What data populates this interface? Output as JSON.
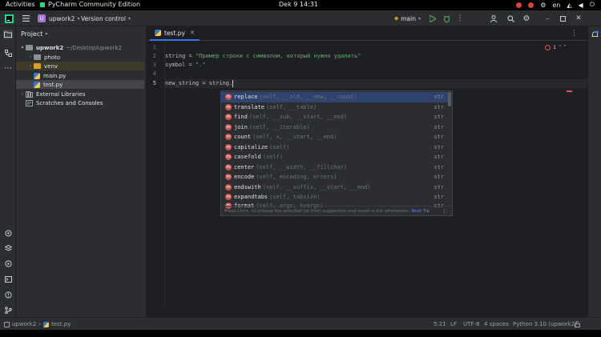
{
  "system_bar": {
    "activities": "Activities",
    "app_name": "PyCharm Community Edition",
    "clock": "Dek 9  14:31",
    "language": "en"
  },
  "toolbar": {
    "project_badge": "U",
    "project_name": "upwork2",
    "vcs": "Version control",
    "run_config": "main"
  },
  "project_panel": {
    "title": "Project",
    "tree": [
      {
        "label": "upwork2",
        "path": "~/Desktop/upwork2",
        "kind": "root"
      },
      {
        "label": "photo",
        "kind": "folder"
      },
      {
        "label": "venv",
        "kind": "folder-excluded"
      },
      {
        "label": "main.py",
        "kind": "py"
      },
      {
        "label": "test.py",
        "kind": "py",
        "selected": true
      },
      {
        "label": "External Libraries",
        "kind": "lib"
      },
      {
        "label": "Scratches and Consoles",
        "kind": "scratch"
      }
    ]
  },
  "editor": {
    "tab_label": "test.py",
    "inspection_count": "1",
    "line_numbers": [
      "1",
      "2",
      "3",
      "4",
      "5"
    ],
    "line2_var": "string = ",
    "line2_str": "\"Пример строки с символом, который нужно удалить\"",
    "line3_var": "symbol = ",
    "line3_str": "\".\"",
    "line5": "new_string = string."
  },
  "completion": {
    "items": [
      {
        "name": "replace",
        "sig": "(self, __old, __new, __count)",
        "type": "str"
      },
      {
        "name": "translate",
        "sig": "(self, __table)",
        "type": "str"
      },
      {
        "name": "find",
        "sig": "(self, __sub, __start, __end)",
        "type": "str"
      },
      {
        "name": "join",
        "sig": "(self, __iterable)",
        "type": "str"
      },
      {
        "name": "count",
        "sig": "(self, x, __start, __end)",
        "type": "str"
      },
      {
        "name": "capitalize",
        "sig": "(self)",
        "type": "str"
      },
      {
        "name": "casefold",
        "sig": "(self)",
        "type": "str"
      },
      {
        "name": "center",
        "sig": "(self, __width, __fillchar)",
        "type": "str"
      },
      {
        "name": "encode",
        "sig": "(self, encoding, errors)",
        "type": "str"
      },
      {
        "name": "endswith",
        "sig": "(self, __suffix, __start, __end)",
        "type": "str"
      },
      {
        "name": "expandtabs",
        "sig": "(self, tabsize)",
        "type": "str"
      },
      {
        "name": "format",
        "sig": "(self, args, kwargs)",
        "type": "str"
      }
    ],
    "footer": "Press Ctrl+. to choose the selected (or first) suggestion and insert a dot afterwards",
    "next_tip": "Next Tip"
  },
  "status_bar": {
    "breadcrumb_project": "upwork2",
    "breadcrumb_file": "test.py",
    "position": "5:21",
    "line_sep": "LF",
    "encoding": "UTF-8",
    "indent": "4 spaces",
    "interpreter": "Python 3.10 (upwork2)"
  },
  "colors": {
    "accent": "#3574f0",
    "string": "#6aab73",
    "method_icon": "#c75450",
    "selection": "#2e436e"
  }
}
